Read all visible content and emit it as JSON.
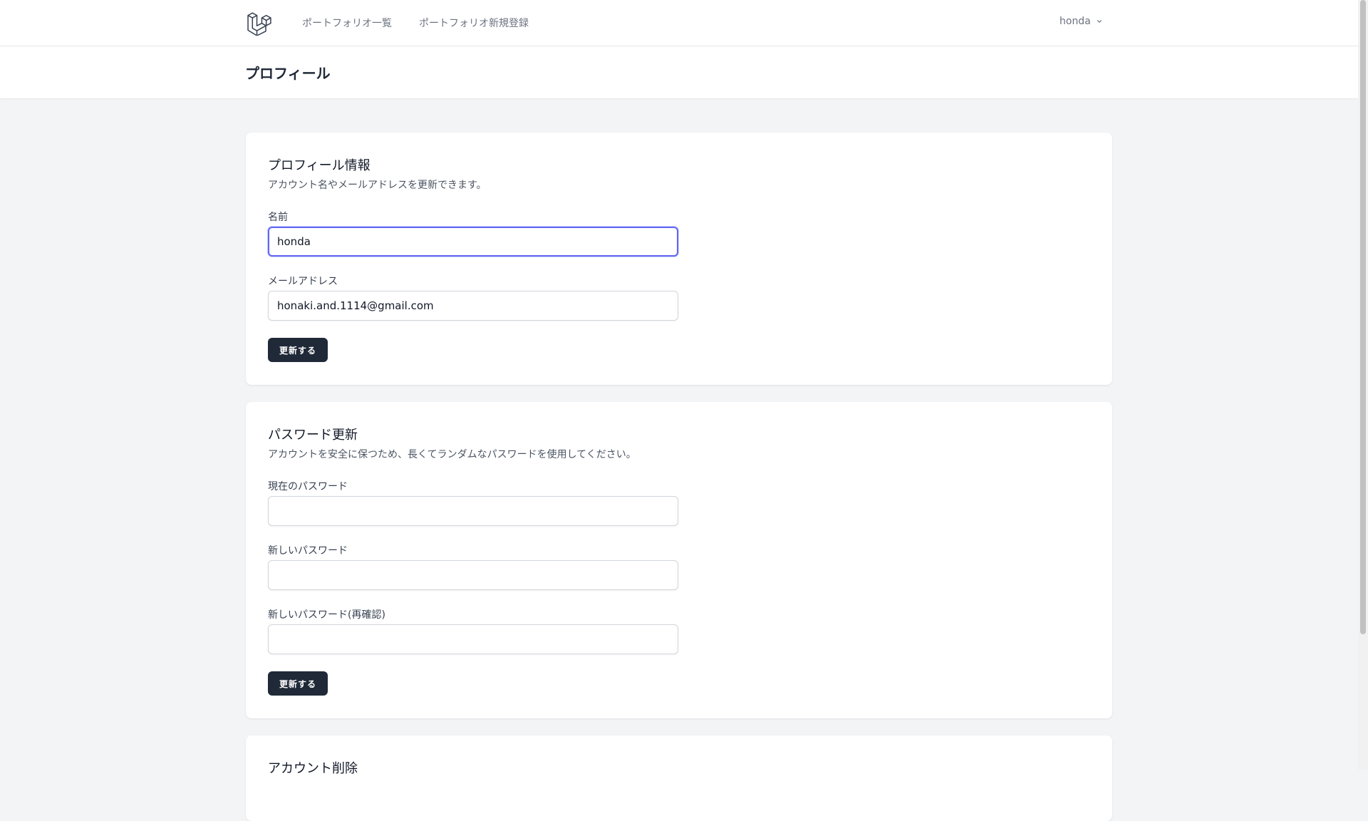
{
  "nav": {
    "logo_icon": "laravel-logo-icon",
    "links": [
      {
        "label": "ポートフォリオ一覧"
      },
      {
        "label": "ポートフォリオ新規登録"
      }
    ],
    "user_name": "honda",
    "user_menu_icon": "chevron-down-icon"
  },
  "header": {
    "title": "プロフィール"
  },
  "profile_section": {
    "title": "プロフィール情報",
    "description": "アカウント名やメールアドレスを更新できます。",
    "name_label": "名前",
    "name_value": "honda",
    "email_label": "メールアドレス",
    "email_value": "honaki.and.1114@gmail.com",
    "submit_label": "更新する"
  },
  "password_section": {
    "title": "パスワード更新",
    "description": "アカウントを安全に保つため、長くてランダムなパスワードを使用してください。",
    "current_label": "現在のパスワード",
    "current_value": "",
    "new_label": "新しいパスワード",
    "new_value": "",
    "confirm_label": "新しいパスワード(再確認)",
    "confirm_value": "",
    "submit_label": "更新する"
  },
  "delete_section": {
    "title": "アカウント削除"
  },
  "colors": {
    "accent_focus": "#6366f1",
    "button_bg": "#1f2937",
    "page_bg": "#f3f4f6"
  }
}
